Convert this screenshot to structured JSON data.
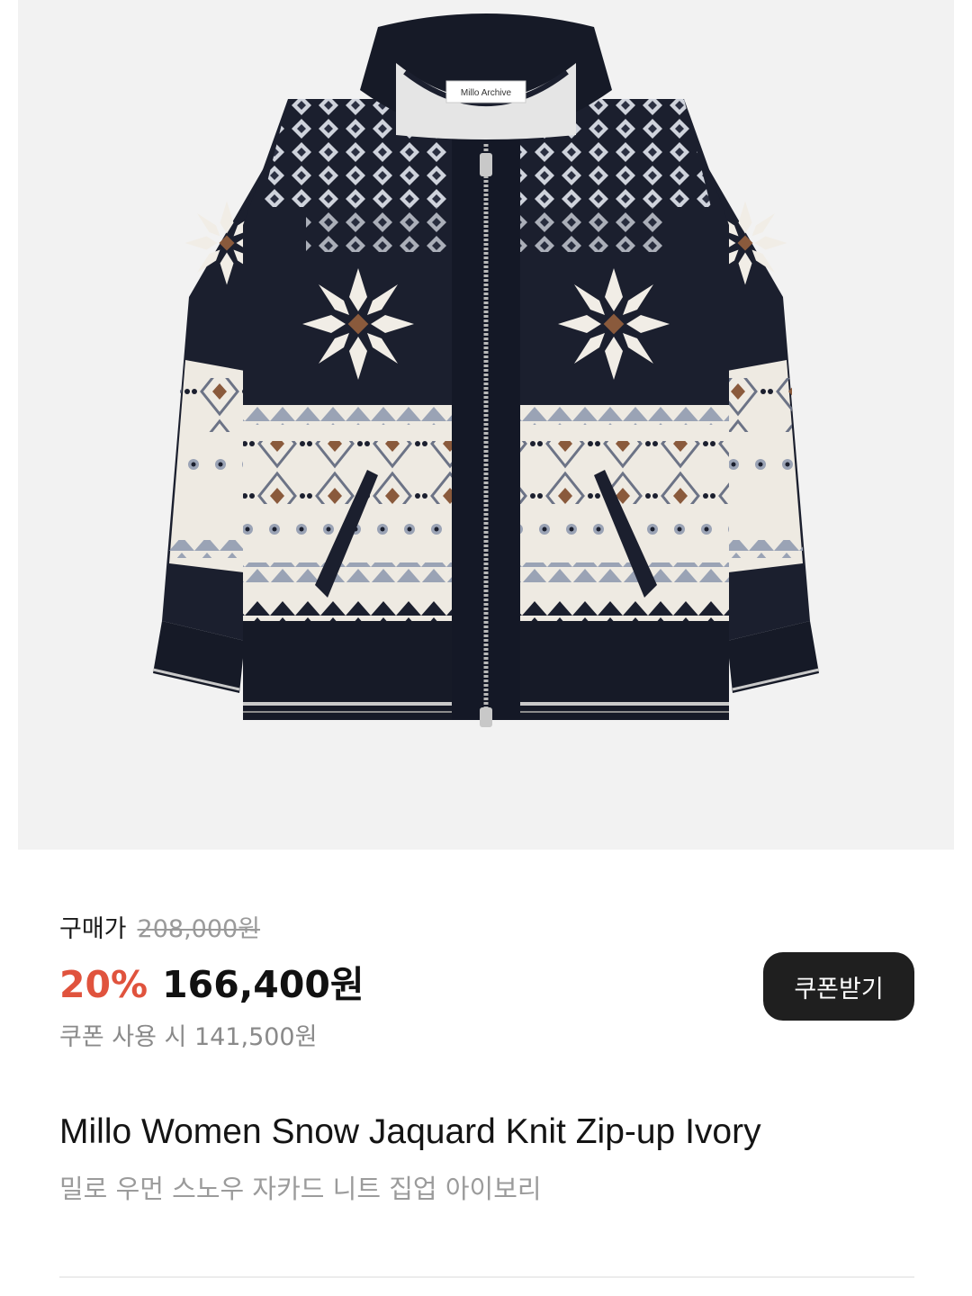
{
  "product_image": {
    "label_text": "Millo Archive",
    "colors": {
      "background": "#f2f2f2",
      "navy": "#1b1f2e",
      "ivory": "#eeeae2",
      "gray_blue": "#9aa3b5",
      "brown": "#8a5a3c"
    }
  },
  "price": {
    "purchase_label": "구매가",
    "original_price": "208,000원",
    "discount_rate": "20%",
    "sale_price": "166,400원",
    "coupon_price_text": "쿠폰 사용 시 141,500원",
    "discount_color": "#e0533d"
  },
  "coupon_button": {
    "label": "쿠폰받기"
  },
  "product": {
    "name_en": "Millo Women Snow Jaquard Knit Zip-up Ivory",
    "name_ko": "밀로 우먼 스노우 자카드 니트 집업 아이보리"
  }
}
